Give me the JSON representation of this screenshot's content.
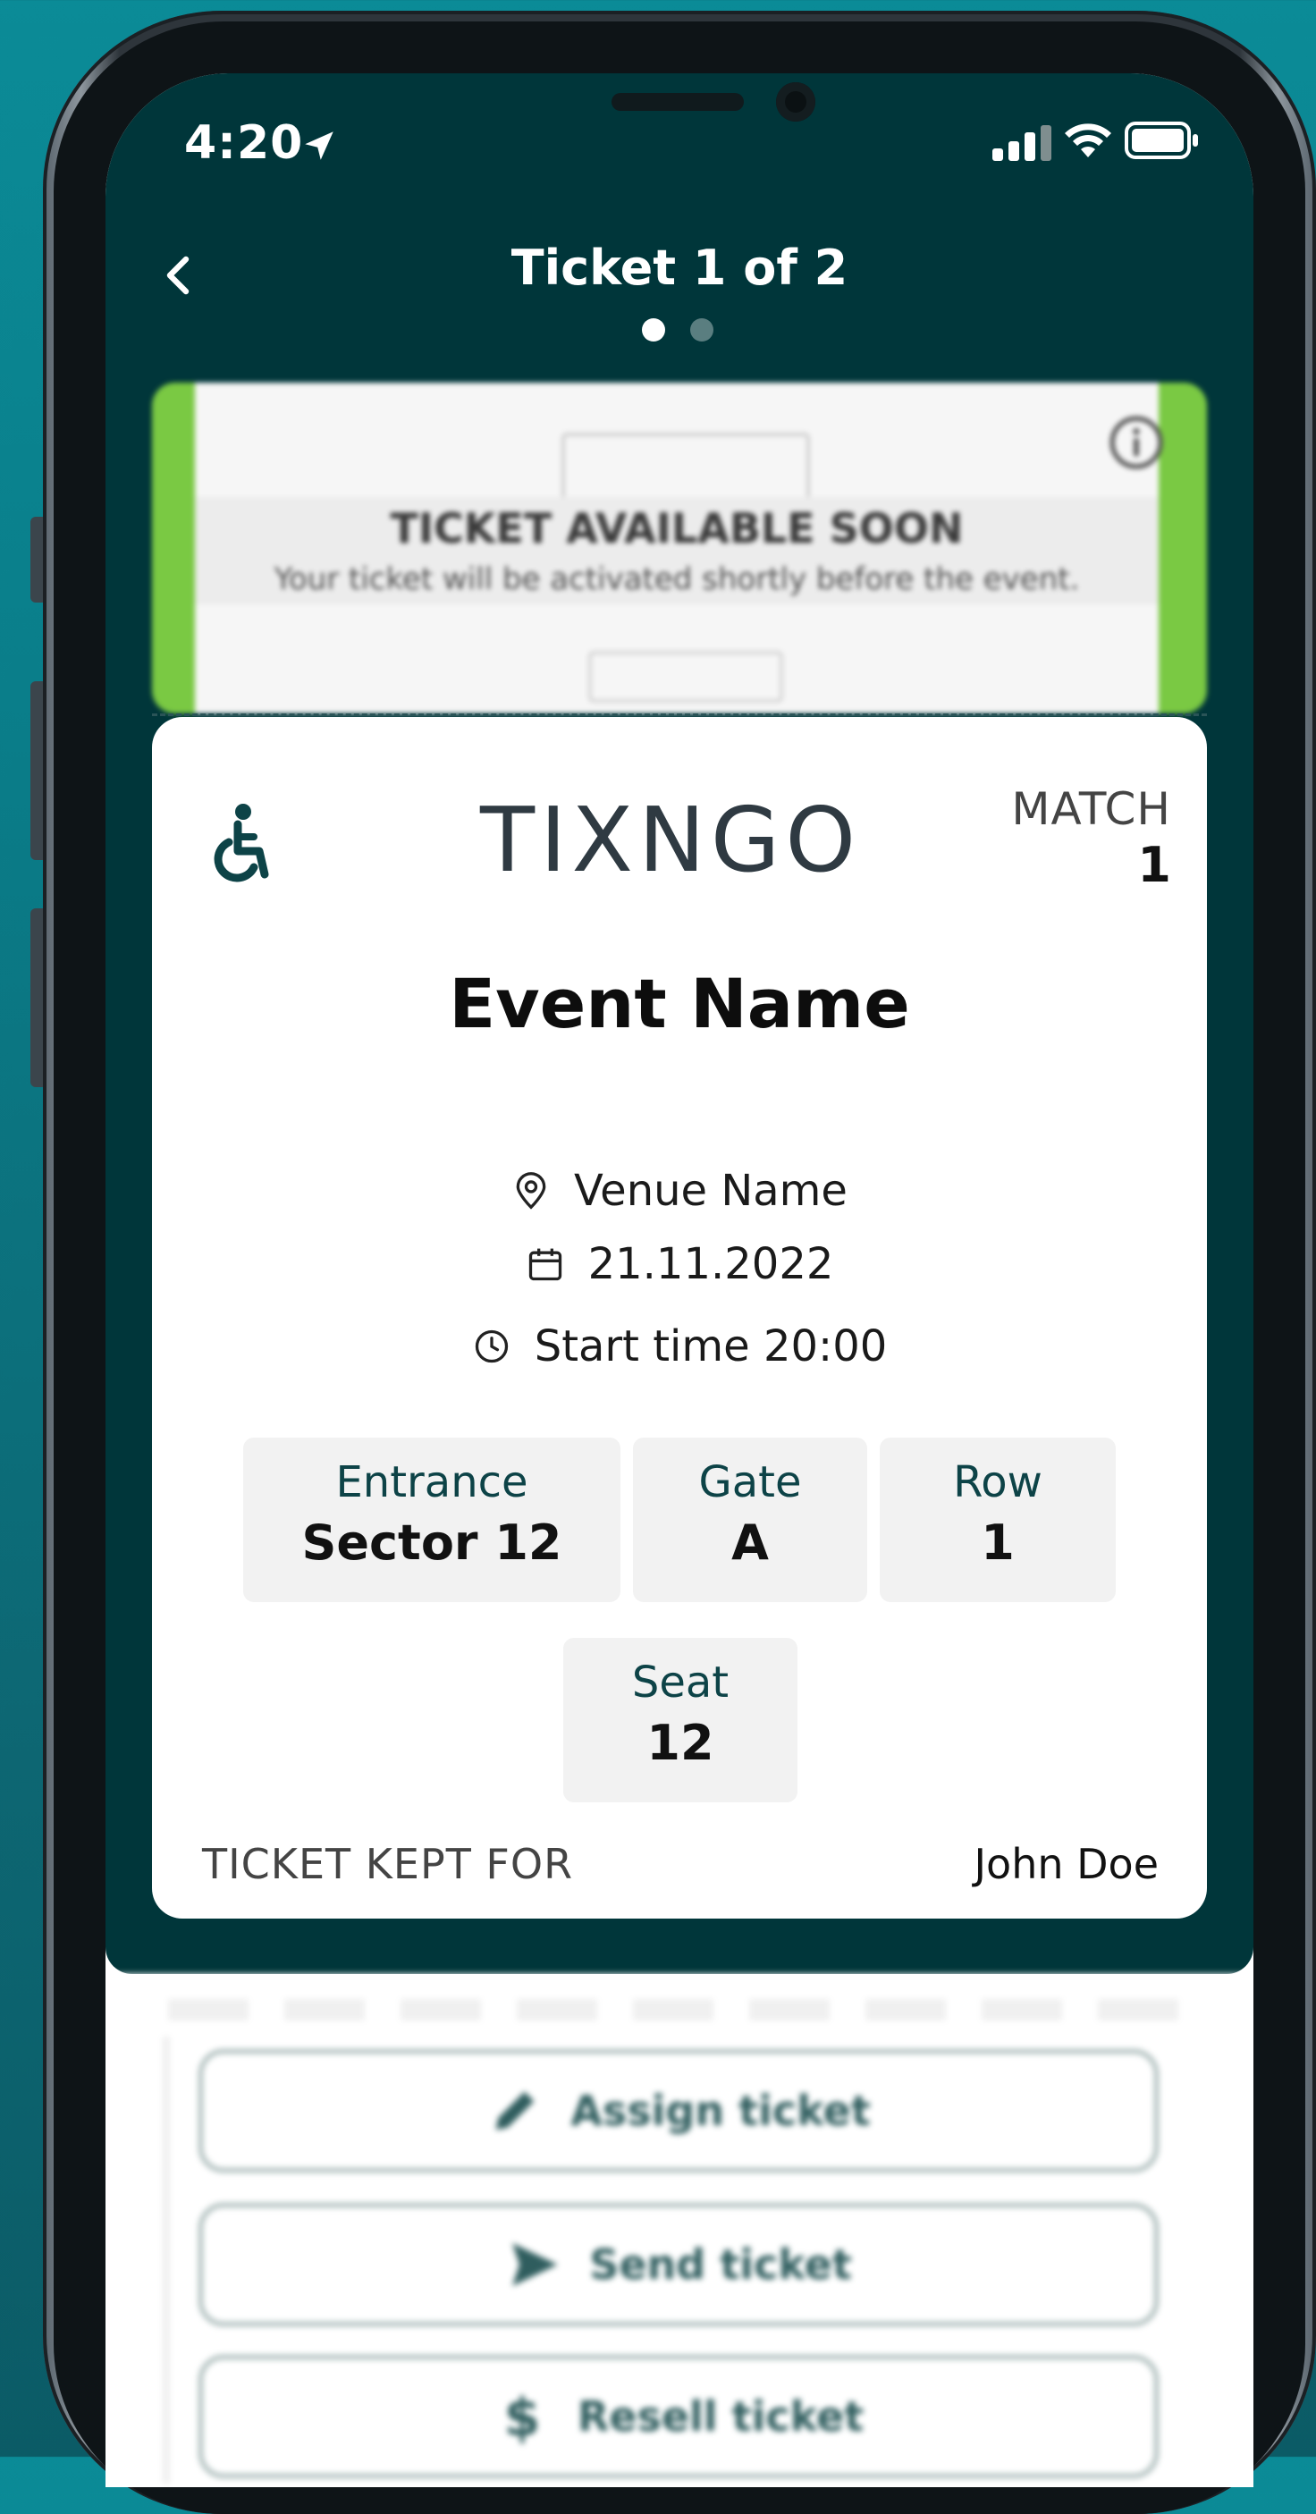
{
  "status_bar": {
    "time": "4:20"
  },
  "nav": {
    "title": "Ticket 1 of 2",
    "pages": 2,
    "active_page": 1
  },
  "banner": {
    "title": "TICKET AVAILABLE SOON",
    "subtitle": "Your ticket will be activated shortly before the event.",
    "accent_color": "#7ac943"
  },
  "ticket": {
    "brand": "TIXNGO",
    "match_label": "MATCH",
    "match_number": "1",
    "event_name": "Event Name",
    "venue": "Venue Name",
    "date": "21.11.2022",
    "start_time": "Start time 20:00",
    "entrance_label": "Entrance",
    "entrance_value": "Sector 12",
    "gate_label": "Gate",
    "gate_value": "A",
    "row_label": "Row",
    "row_value": "1",
    "seat_label": "Seat",
    "seat_value": "12",
    "kept_for_label": "TICKET KEPT FOR",
    "kept_for_name": "John Doe"
  },
  "actions": {
    "assign": "Assign ticket",
    "send": "Send ticket",
    "resell": "Resell ticket"
  },
  "colors": {
    "header_bg": "#00363a",
    "accent_teal": "#0d4347"
  }
}
